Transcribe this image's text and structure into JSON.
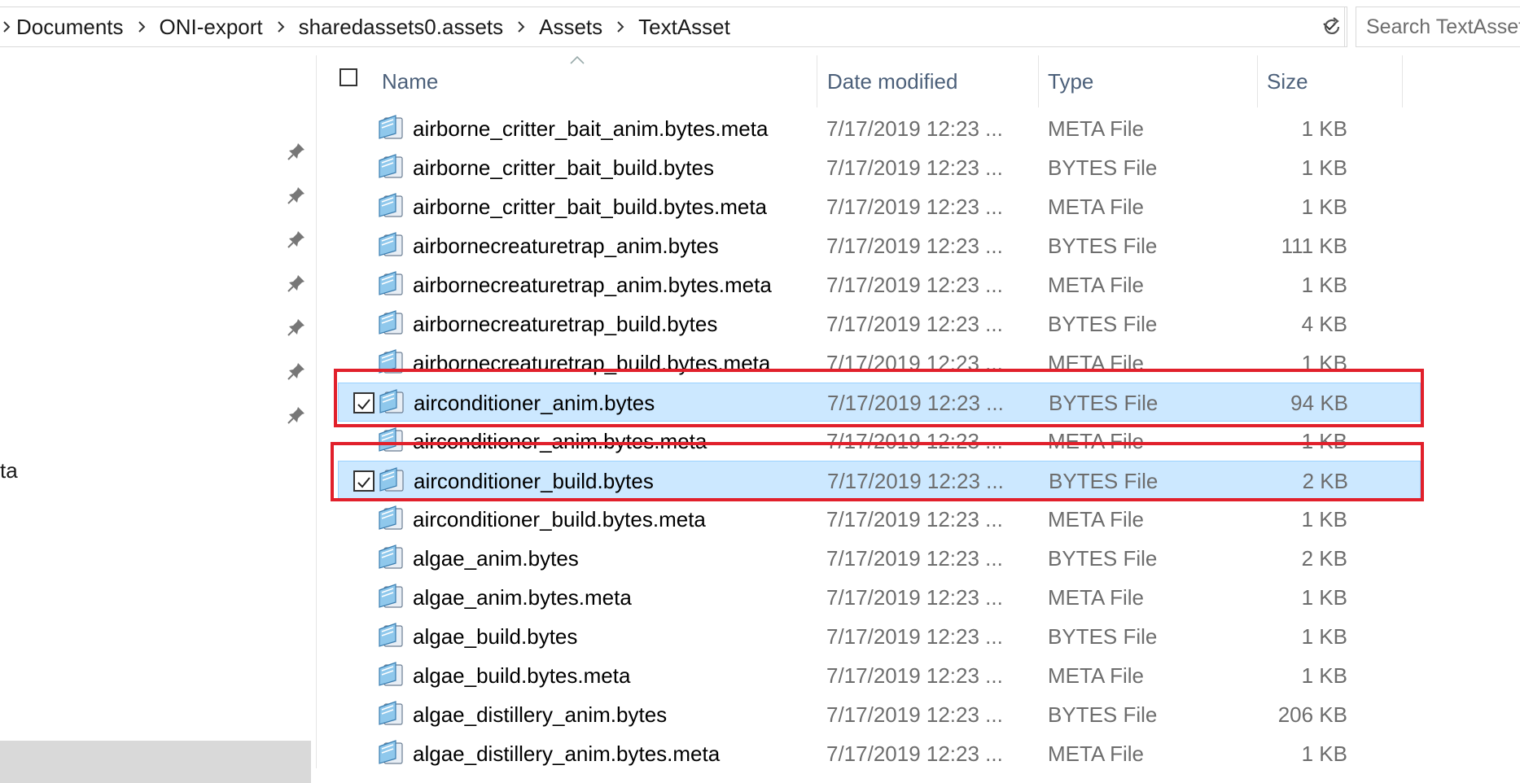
{
  "breadcrumb": [
    "Documents",
    "ONI-export",
    "sharedassets0.assets",
    "Assets",
    "TextAsset"
  ],
  "search": {
    "placeholder": "Search TextAsset"
  },
  "nav": {
    "partial_label": "ta"
  },
  "columns": {
    "name": "Name",
    "date": "Date modified",
    "type": "Type",
    "size": "Size"
  },
  "files": [
    {
      "name": "airborne_critter_bait_anim.bytes.meta",
      "date": "7/17/2019 12:23 ...",
      "type": "META File",
      "size": "1 KB",
      "selected": false
    },
    {
      "name": "airborne_critter_bait_build.bytes",
      "date": "7/17/2019 12:23 ...",
      "type": "BYTES File",
      "size": "1 KB",
      "selected": false
    },
    {
      "name": "airborne_critter_bait_build.bytes.meta",
      "date": "7/17/2019 12:23 ...",
      "type": "META File",
      "size": "1 KB",
      "selected": false
    },
    {
      "name": "airbornecreaturetrap_anim.bytes",
      "date": "7/17/2019 12:23 ...",
      "type": "BYTES File",
      "size": "111 KB",
      "selected": false
    },
    {
      "name": "airbornecreaturetrap_anim.bytes.meta",
      "date": "7/17/2019 12:23 ...",
      "type": "META File",
      "size": "1 KB",
      "selected": false
    },
    {
      "name": "airbornecreaturetrap_build.bytes",
      "date": "7/17/2019 12:23 ...",
      "type": "BYTES File",
      "size": "4 KB",
      "selected": false
    },
    {
      "name": "airbornecreaturetrap_build.bytes.meta",
      "date": "7/17/2019 12:23 ...",
      "type": "META File",
      "size": "1 KB",
      "selected": false
    },
    {
      "name": "airconditioner_anim.bytes",
      "date": "7/17/2019 12:23 ...",
      "type": "BYTES File",
      "size": "94 KB",
      "selected": true
    },
    {
      "name": "airconditioner_anim.bytes.meta",
      "date": "7/17/2019 12:23 ...",
      "type": "META File",
      "size": "1 KB",
      "selected": false
    },
    {
      "name": "airconditioner_build.bytes",
      "date": "7/17/2019 12:23 ...",
      "type": "BYTES File",
      "size": "2 KB",
      "selected": true
    },
    {
      "name": "airconditioner_build.bytes.meta",
      "date": "7/17/2019 12:23 ...",
      "type": "META File",
      "size": "1 KB",
      "selected": false
    },
    {
      "name": "algae_anim.bytes",
      "date": "7/17/2019 12:23 ...",
      "type": "BYTES File",
      "size": "2 KB",
      "selected": false
    },
    {
      "name": "algae_anim.bytes.meta",
      "date": "7/17/2019 12:23 ...",
      "type": "META File",
      "size": "1 KB",
      "selected": false
    },
    {
      "name": "algae_build.bytes",
      "date": "7/17/2019 12:23 ...",
      "type": "BYTES File",
      "size": "1 KB",
      "selected": false
    },
    {
      "name": "algae_build.bytes.meta",
      "date": "7/17/2019 12:23 ...",
      "type": "META File",
      "size": "1 KB",
      "selected": false
    },
    {
      "name": "algae_distillery_anim.bytes",
      "date": "7/17/2019 12:23 ...",
      "type": "BYTES File",
      "size": "206 KB",
      "selected": false
    },
    {
      "name": "algae_distillery_anim.bytes.meta",
      "date": "7/17/2019 12:23 ...",
      "type": "META File",
      "size": "1 KB",
      "selected": false
    }
  ],
  "colors": {
    "selection": "#cce8ff",
    "selection_border": "#99d1ff",
    "annotation": "#e1202b",
    "header_text": "#4c607a"
  }
}
